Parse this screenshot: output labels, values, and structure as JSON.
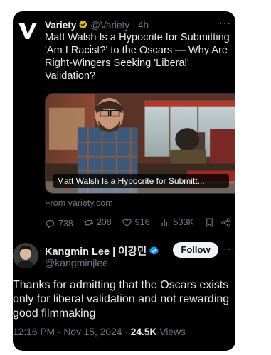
{
  "quoted_tweet": {
    "author_name": "Variety",
    "handle": "@Variety",
    "time": "4h",
    "title": "Matt Walsh Is a Hypocrite for Submitting 'Am I Racist?' to the Oscars — Why Are Right-Wingers Seeking 'Liberal' Validation?",
    "card_caption": "Matt Walsh Is a Hypocrite for Submitt...",
    "source": "From variety.com",
    "actions": {
      "replies": "738",
      "reposts": "208",
      "likes": "916",
      "views": "533K"
    }
  },
  "reply_tweet": {
    "author_name": "Kangmin Lee | 이강민",
    "handle": "@kangminjlee",
    "follow_label": "Follow",
    "text": "Thanks for admitting that the Oscars exists only for liberal validation and not rewarding good filmmaking",
    "time": "12:16 PM",
    "date": "Nov 15, 2024",
    "views_count": "24.5K",
    "views_label": "Views"
  },
  "colors": {
    "background": "#000000",
    "text": "#e7e9ea",
    "muted": "#71767b",
    "verified_gold": "#e2b719",
    "verified_blue": "#1d9bf0"
  }
}
